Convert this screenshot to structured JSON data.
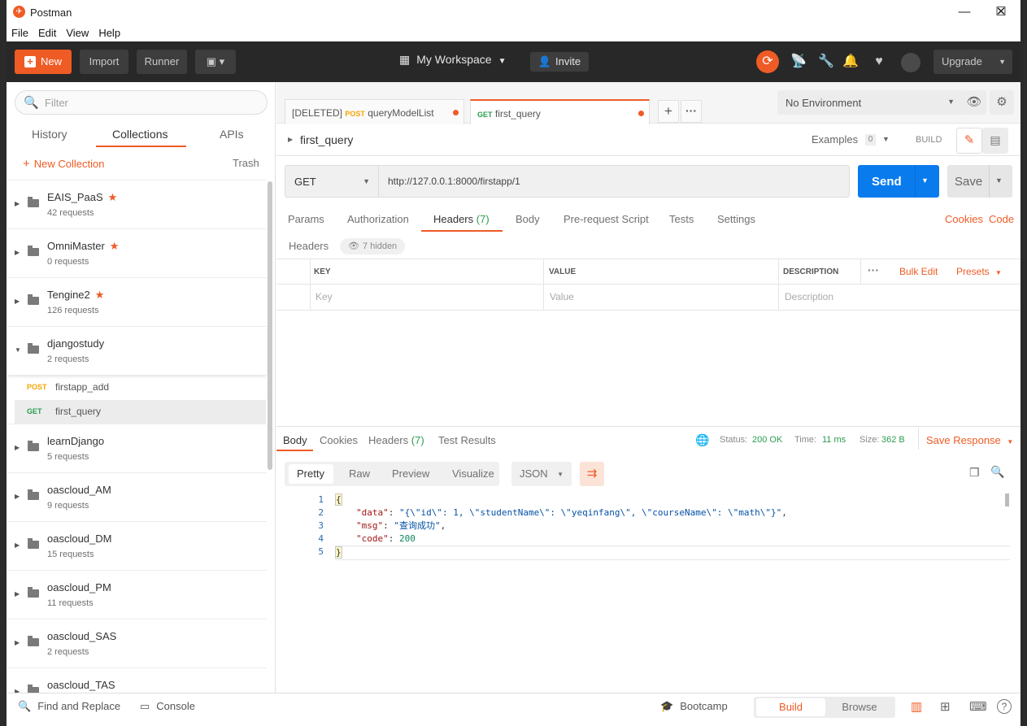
{
  "window": {
    "title": "Postman",
    "minimize": "—",
    "maximize": "☐",
    "close": "✕"
  },
  "menu": [
    "File",
    "Edit",
    "View",
    "Help"
  ],
  "toolbar": {
    "new_label": "New",
    "import_label": "Import",
    "runner_label": "Runner",
    "workspace_label": "My Workspace",
    "invite_label": "Invite",
    "upgrade_label": "Upgrade",
    "accent": "#ef5b25"
  },
  "sidebar": {
    "filter_placeholder": "Filter",
    "tabs": [
      "History",
      "Collections",
      "APIs"
    ],
    "active_tab": "Collections",
    "new_collection": "New Collection",
    "trash": "Trash",
    "collections": [
      {
        "name": "EAIS_PaaS",
        "requests": "42 requests",
        "starred": true
      },
      {
        "name": "OmniMaster",
        "requests": "0 requests",
        "starred": true
      },
      {
        "name": "Tengine2",
        "requests": "126 requests",
        "starred": true
      },
      {
        "name": "djangostudy",
        "requests": "2 requests",
        "starred": false,
        "expanded": true
      }
    ],
    "djangostudy_requests": [
      {
        "method": "POST",
        "name": "firstapp_add"
      },
      {
        "method": "GET",
        "name": "first_query",
        "selected": true
      }
    ],
    "more_collections": [
      {
        "name": "learnDjango",
        "requests": "5 requests"
      },
      {
        "name": "oascloud_AM",
        "requests": "9 requests"
      },
      {
        "name": "oascloud_DM",
        "requests": "15 requests"
      },
      {
        "name": "oascloud_PM",
        "requests": "11 requests"
      },
      {
        "name": "oascloud_SAS",
        "requests": "2 requests"
      },
      {
        "name": "oascloud_TAS",
        "requests": ""
      }
    ]
  },
  "tabs": [
    {
      "prefix": "[DELETED]",
      "method": "POST",
      "name": "queryModelList"
    },
    {
      "prefix": "",
      "method": "GET",
      "name": "first_query",
      "active": true
    }
  ],
  "environment": {
    "selected": "No Environment"
  },
  "request": {
    "name": "first_query",
    "examples_label": "Examples",
    "examples_count": "0",
    "build_label": "BUILD",
    "method": "GET",
    "url": "http://127.0.0.1:8000/firstapp/1",
    "send_label": "Send",
    "save_label": "Save",
    "tabs": [
      "Params",
      "Authorization",
      "Headers",
      "Body",
      "Pre-request Script",
      "Tests",
      "Settings"
    ],
    "headers_count": "(7)",
    "cookies_link": "Cookies",
    "code_link": "Code",
    "headers_label": "Headers",
    "hidden_label": "7 hidden",
    "table_cols": [
      "KEY",
      "VALUE",
      "DESCRIPTION"
    ],
    "bulk_edit": "Bulk Edit",
    "presets": "Presets",
    "placeholders": {
      "key": "Key",
      "value": "Value",
      "description": "Description"
    }
  },
  "response": {
    "tabs": [
      "Body",
      "Cookies",
      "Headers",
      "Test Results"
    ],
    "headers_count": "(7)",
    "status_label": "Status:",
    "status": "200 OK",
    "time_label": "Time:",
    "time": "11 ms",
    "size_label": "Size:",
    "size": "362 B",
    "save_response": "Save Response",
    "view_modes": [
      "Pretty",
      "Raw",
      "Preview",
      "Visualize"
    ],
    "format": "JSON",
    "lines": [
      {
        "n": "1",
        "text": "{"
      },
      {
        "n": "2",
        "key": "\"data\"",
        "sep": ": ",
        "val": "\"{\\\"id\\\": 1, \\\"studentName\\\": \\\"yeqinfang\\\", \\\"courseName\\\": \\\"math\\\"}\"",
        "end": ","
      },
      {
        "n": "3",
        "key": "\"msg\"",
        "sep": ": ",
        "val": "\"查询成功\"",
        "end": ","
      },
      {
        "n": "4",
        "key": "\"code\"",
        "sep": ": ",
        "val": "200",
        "end": ""
      },
      {
        "n": "5",
        "text": "}"
      }
    ]
  },
  "footer": {
    "find_replace": "Find and Replace",
    "console": "Console",
    "bootcamp": "Bootcamp",
    "build": "Build",
    "browse": "Browse",
    "help": "?"
  }
}
